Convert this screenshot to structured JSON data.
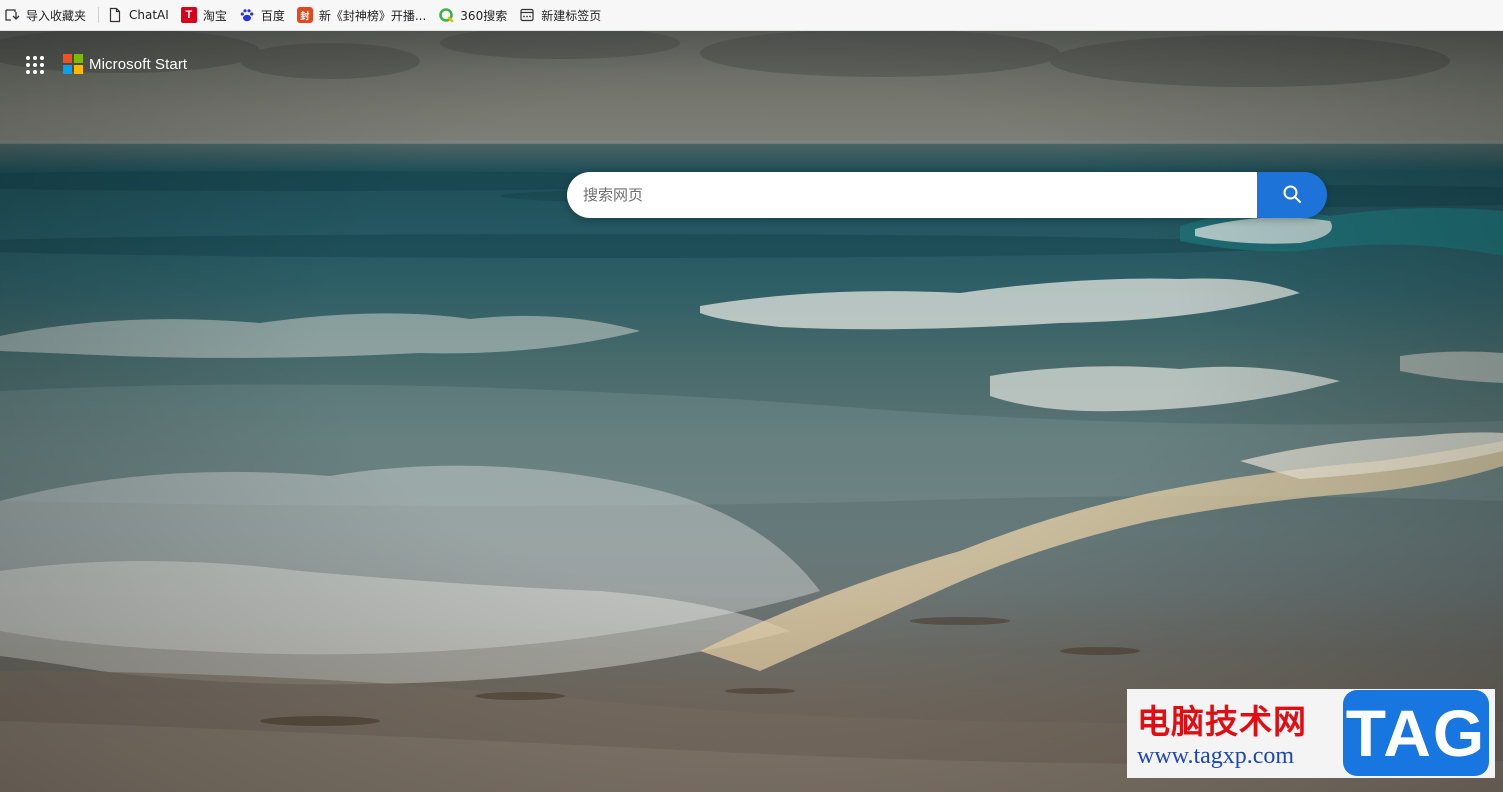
{
  "bookmarks": {
    "items": [
      {
        "label": "导入收藏夹",
        "icon": "import-favorites-icon"
      },
      {
        "label": "ChatAI",
        "icon": "page-icon"
      },
      {
        "label": "淘宝",
        "icon": "taobao-icon",
        "glyph": "T"
      },
      {
        "label": "百度",
        "icon": "baidu-paw-icon"
      },
      {
        "label": "新《封神榜》开播...",
        "icon": "game-icon",
        "glyph": "封"
      },
      {
        "label": "360搜索",
        "icon": "360-search-icon"
      },
      {
        "label": "新建标签页",
        "icon": "new-tab-icon"
      }
    ]
  },
  "header": {
    "brand_name": "Microsoft Start",
    "logo_colors": [
      "#f25022",
      "#7fba00",
      "#00a4ef",
      "#ffb900"
    ]
  },
  "search": {
    "placeholder": "搜索网页",
    "value": "",
    "button_color": "#1e73d8"
  },
  "watermark": {
    "title": "电脑技术网",
    "url": "www.tagxp.com",
    "badge": "TAG"
  }
}
